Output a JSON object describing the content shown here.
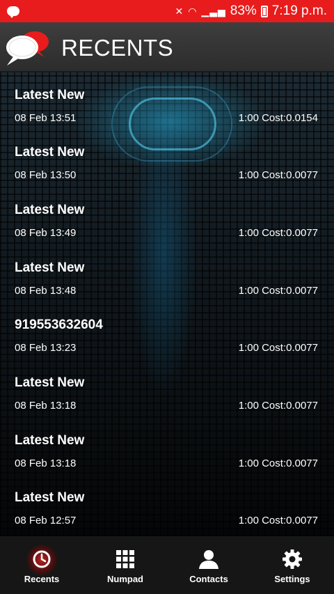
{
  "status_bar": {
    "battery": "83%",
    "time": "7:19 p.m.",
    "background": "#e81c1c"
  },
  "app_bar": {
    "title": "RECENTS",
    "logo_icon": "speech-bubbles-icon"
  },
  "calls": [
    {
      "name": "Latest New",
      "date": "08 Feb  13:51",
      "cost": "1:00 Cost:0.0154"
    },
    {
      "name": "Latest New",
      "date": "08 Feb  13:50",
      "cost": "1:00 Cost:0.0077"
    },
    {
      "name": "Latest New",
      "date": "08 Feb  13:49",
      "cost": "1:00 Cost:0.0077"
    },
    {
      "name": "Latest New",
      "date": "08 Feb  13:48",
      "cost": "1:00 Cost:0.0077"
    },
    {
      "name": "919553632604",
      "date": "08 Feb  13:23",
      "cost": "1:00 Cost:0.0077"
    },
    {
      "name": "Latest New",
      "date": "08 Feb  13:18",
      "cost": "1:00 Cost:0.0077"
    },
    {
      "name": "Latest New",
      "date": "08 Feb  13:18",
      "cost": "1:00 Cost:0.0077"
    },
    {
      "name": "Latest New",
      "date": "08 Feb  12:57",
      "cost": "1:00 Cost:0.0077"
    }
  ],
  "bottom_nav": {
    "items": [
      {
        "label": "Recents",
        "icon": "clock-icon",
        "active": true
      },
      {
        "label": "Numpad",
        "icon": "grid-icon",
        "active": false
      },
      {
        "label": "Contacts",
        "icon": "person-icon",
        "active": false
      },
      {
        "label": "Settings",
        "icon": "gear-icon",
        "active": false
      }
    ],
    "accent": "#e81c1c"
  }
}
